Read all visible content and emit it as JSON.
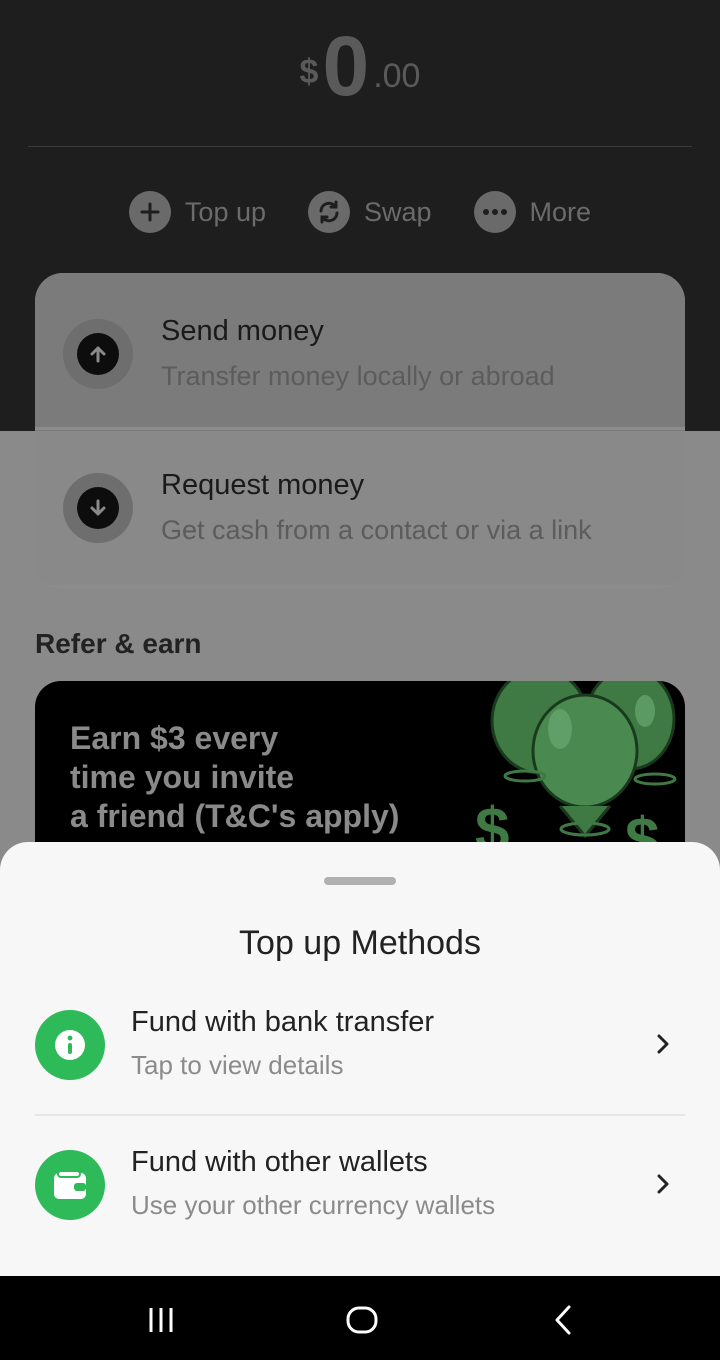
{
  "balance": {
    "currency": "$",
    "whole": "0",
    "decimal": ".00"
  },
  "actions": [
    {
      "label": "Top up",
      "icon": "plus-icon"
    },
    {
      "label": "Swap",
      "icon": "swap-icon"
    },
    {
      "label": "More",
      "icon": "more-icon"
    }
  ],
  "transfer": {
    "send": {
      "title": "Send money",
      "subtitle": "Transfer money locally or abroad",
      "icon": "arrow-up-icon"
    },
    "request": {
      "title": "Request money",
      "subtitle": "Get cash from a contact or via a link",
      "icon": "arrow-down-icon"
    }
  },
  "refer": {
    "title": "Refer & earn",
    "banner_lines": [
      "Earn $3 every",
      "time you invite",
      "a friend (T&C's apply)"
    ]
  },
  "sheet": {
    "title": "Top up Methods",
    "methods": [
      {
        "title": "Fund with bank transfer",
        "subtitle": "Tap to view details",
        "icon": "info-icon"
      },
      {
        "title": "Fund with other wallets",
        "subtitle": "Use your other currency wallets",
        "icon": "wallet-icon"
      }
    ]
  },
  "colors": {
    "accent_green": "#2fba5a",
    "overlay_dark": "#1e1e1e",
    "sheet_bg": "#f7f7f7"
  }
}
